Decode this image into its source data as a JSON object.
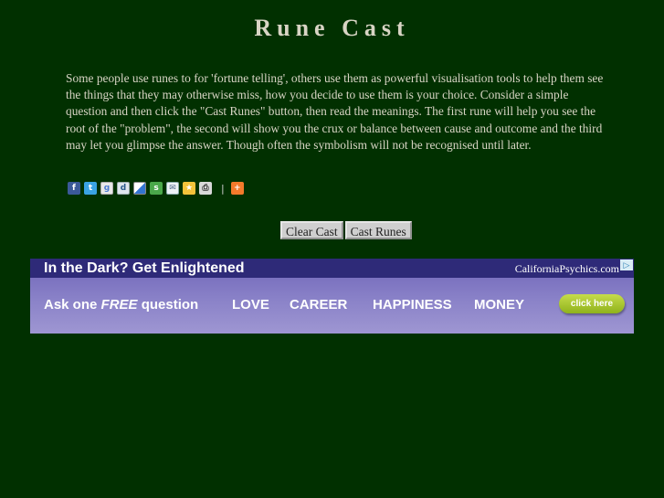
{
  "title": "Rune Cast",
  "intro": "Some people use runes to for 'fortune telling', others use them as powerful visualisation tools to help them see the things that they may otherwise miss, how you decide to use them is your choice. Consider a simple question and then click the \"Cast Runes\" button, then read the meanings. The first rune will help you see the root of the \"problem\", the second will show you the crux or balance between cause and outcome and the third may let you glimpse the answer. Though often the symbolism will not be recognised until later.",
  "share": {
    "separator": "|",
    "icons": [
      "facebook-icon",
      "twitter-icon",
      "google-bookmark-icon",
      "digg-icon",
      "delicious-icon",
      "stumbleupon-icon",
      "email-icon",
      "favorites-icon",
      "print-icon",
      "more-share-icon"
    ]
  },
  "buttons": {
    "clear": "Clear Cast",
    "cast": "Cast Runes"
  },
  "ad": {
    "headline": "In the Dark? Get Enlightened",
    "brand": "CaliforniaPsychics.com",
    "ask_prefix": "Ask one ",
    "ask_free": "FREE",
    "ask_suffix": " question",
    "categories": [
      "LOVE",
      "CAREER",
      "HAPPINESS",
      "MONEY"
    ],
    "cta": "click here",
    "adchoice": "▷"
  },
  "colors": {
    "background": "#013000",
    "text": "#d8d4c4",
    "ad_dark": "#2e2a78",
    "ad_cta": "#a6c62a"
  }
}
